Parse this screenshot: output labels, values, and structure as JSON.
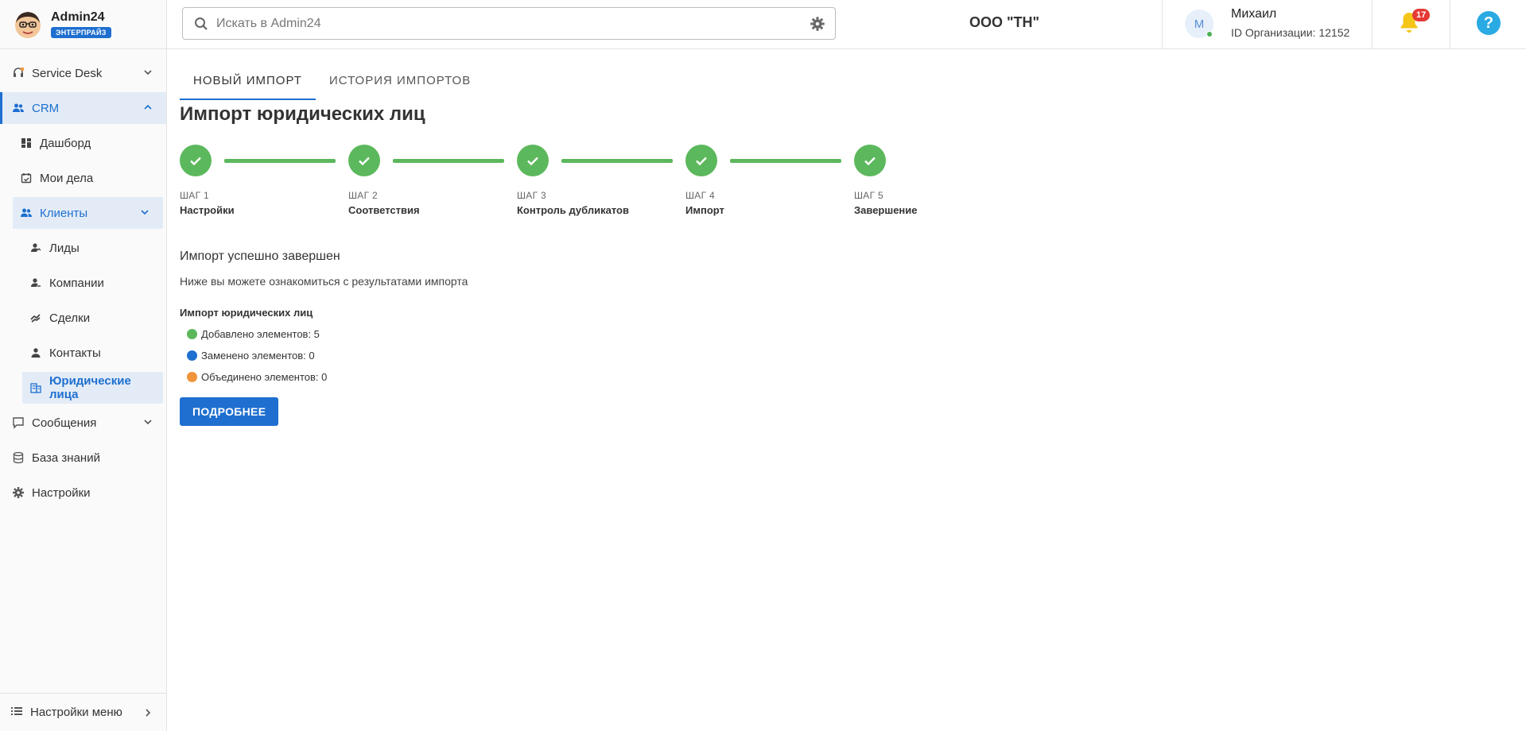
{
  "brand": {
    "name": "Admin24",
    "badge": "ЭНТЕРПРАЙЗ"
  },
  "sidebar": {
    "items": [
      {
        "label": "Service Desk",
        "icon": "headset-icon"
      },
      {
        "label": "CRM",
        "icon": "people-icon"
      },
      {
        "label": "Дашборд",
        "icon": "dashboard-icon"
      },
      {
        "label": "Мои дела",
        "icon": "calendar-check-icon"
      },
      {
        "label": "Клиенты",
        "icon": "people-icon"
      },
      {
        "label": "Лиды",
        "icon": "person-lead-icon"
      },
      {
        "label": "Компании",
        "icon": "person-company-icon"
      },
      {
        "label": "Сделки",
        "icon": "handshake-icon"
      },
      {
        "label": "Контакты",
        "icon": "person-icon"
      },
      {
        "label": "Юридические лица",
        "icon": "building-icon"
      },
      {
        "label": "Сообщения",
        "icon": "chat-icon"
      },
      {
        "label": "База знаний",
        "icon": "database-icon"
      },
      {
        "label": "Настройки",
        "icon": "gear-icon"
      }
    ],
    "menu_settings": "Настройки меню"
  },
  "header": {
    "search_placeholder": "Искать в Admin24",
    "org_name": "ООО \"ТН\"",
    "avatar_initial": "М",
    "user_name": "Михаил",
    "org_id": "ID Организации: 12152",
    "notifications": "17"
  },
  "main": {
    "tabs": [
      "НОВЫЙ ИМПОРТ",
      "ИСТОРИЯ ИМПОРТОВ"
    ],
    "title": "Импорт юридических лиц",
    "steps": [
      {
        "num": "ШАГ 1",
        "label": "Настройки"
      },
      {
        "num": "ШАГ 2",
        "label": "Соответствия"
      },
      {
        "num": "ШАГ 3",
        "label": "Контроль дубликатов"
      },
      {
        "num": "ШАГ 4",
        "label": "Импорт"
      },
      {
        "num": "ШАГ 5",
        "label": "Завершение"
      }
    ],
    "result_title": "Импорт успешно завершен",
    "result_subtitle": "Ниже вы можете ознакомиться с результатами импорта",
    "stats_title": "Импорт юридических лиц",
    "stats": [
      {
        "label": "Добавлено элементов: 5",
        "color": "#5cb85c"
      },
      {
        "label": "Заменено элементов: 0",
        "color": "#1e6fd0"
      },
      {
        "label": "Объединено элементов: 0",
        "color": "#f0953a"
      }
    ],
    "more_button": "ПОДРОБНЕЕ"
  },
  "colors": {
    "accent": "#1e6fd0",
    "success": "#5cb85c"
  }
}
